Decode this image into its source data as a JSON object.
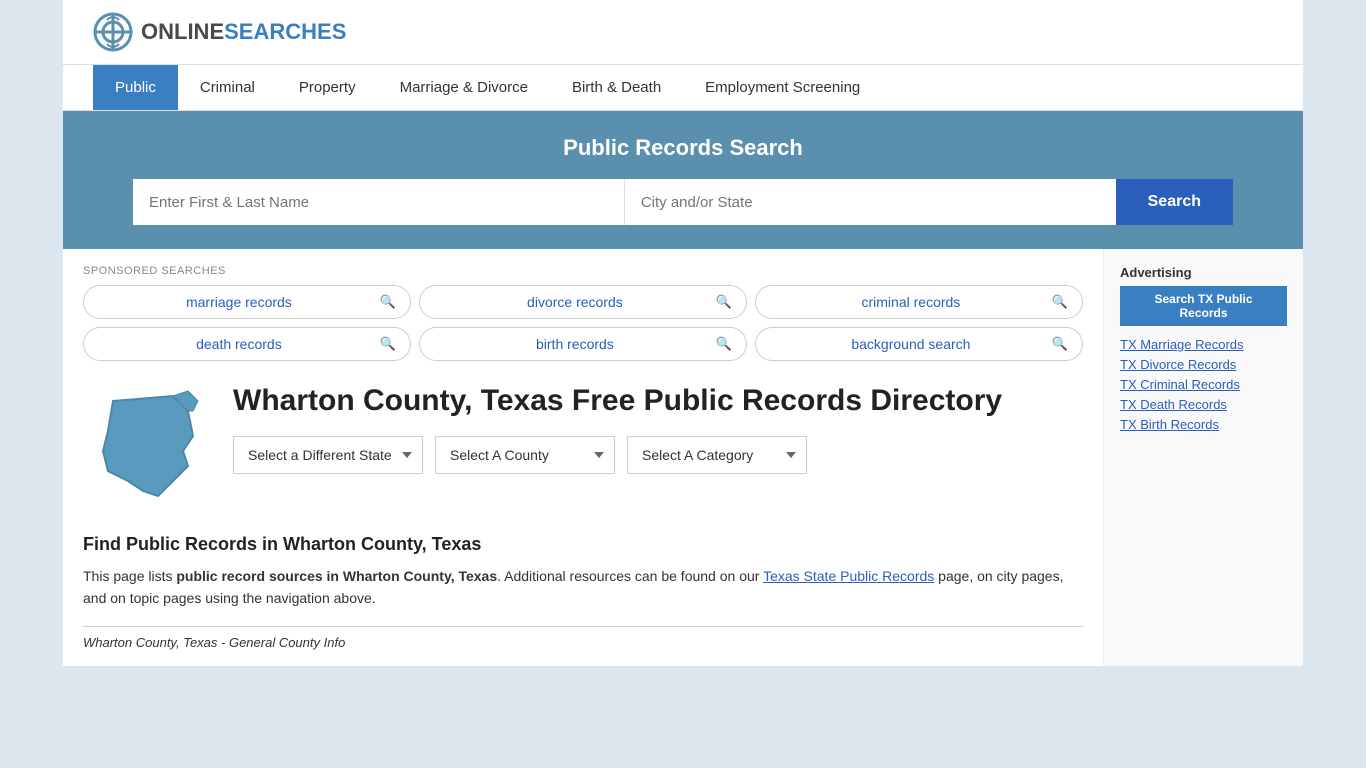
{
  "logo": {
    "text_online": "ONLINE",
    "text_searches": "SEARCHES"
  },
  "nav": {
    "items": [
      {
        "label": "Public",
        "active": true
      },
      {
        "label": "Criminal",
        "active": false
      },
      {
        "label": "Property",
        "active": false
      },
      {
        "label": "Marriage & Divorce",
        "active": false
      },
      {
        "label": "Birth & Death",
        "active": false
      },
      {
        "label": "Employment Screening",
        "active": false
      }
    ]
  },
  "search_banner": {
    "title": "Public Records Search",
    "name_placeholder": "Enter First & Last Name",
    "location_placeholder": "City and/or State",
    "button_label": "Search"
  },
  "sponsored": {
    "label": "SPONSORED SEARCHES",
    "items": [
      "marriage records",
      "divorce records",
      "criminal records",
      "death records",
      "birth records",
      "background search"
    ]
  },
  "county": {
    "title": "Wharton County, Texas Free Public Records Directory"
  },
  "dropdowns": {
    "state_label": "Select a Different State",
    "county_label": "Select A County",
    "category_label": "Select A Category"
  },
  "find_records": {
    "heading": "Find Public Records in Wharton County, Texas",
    "text_part1": "This page lists ",
    "bold1": "public record sources in Wharton County, Texas",
    "text_part2": ". Additional resources can be found on our ",
    "link_text": "Texas State Public Records",
    "text_part3": " page, on city pages, and on topic pages using the navigation above."
  },
  "general_info_bar": "Wharton County, Texas - General County Info",
  "sidebar": {
    "ad_label": "Advertising",
    "ad_button": "Search TX Public Records",
    "links": [
      "TX Marriage Records",
      "TX Divorce Records",
      "TX Criminal Records",
      "TX Death Records",
      "TX Birth Records"
    ]
  }
}
